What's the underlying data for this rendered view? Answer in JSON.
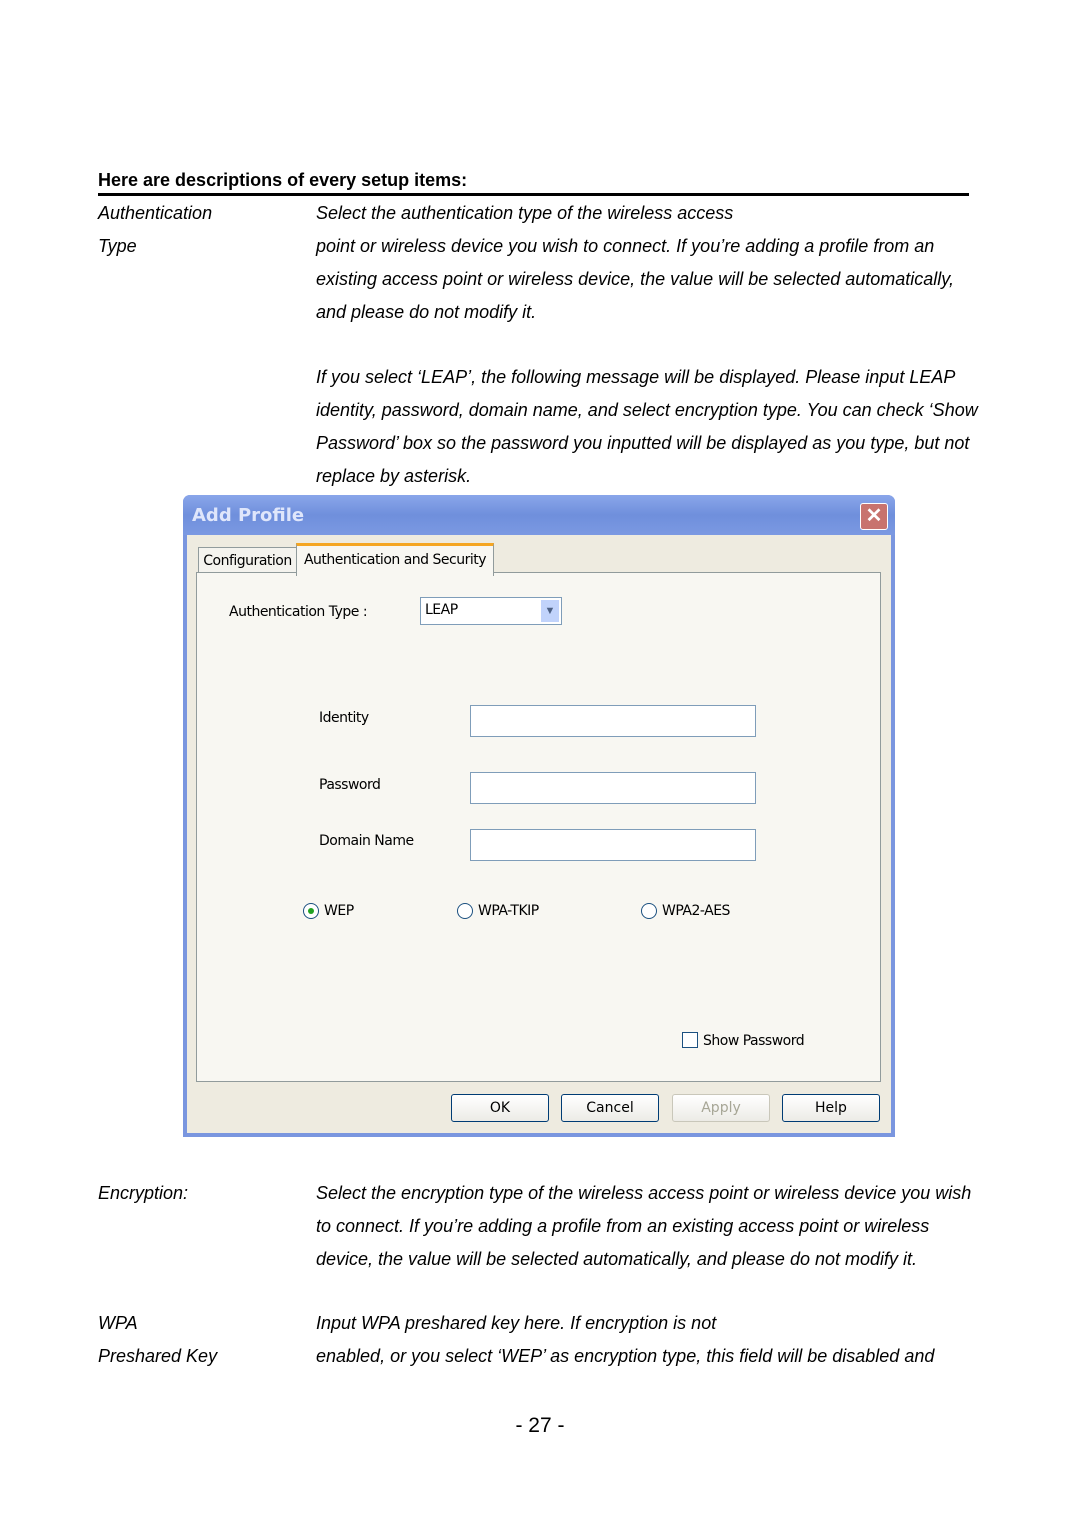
{
  "heading": "Here are descriptions of every setup items:",
  "items": [
    {
      "term": [
        "Authentication",
        "Type"
      ],
      "lines": [
        "Select the authentication type of the wireless access",
        "point or wireless device you wish to connect. If you’re adding a profile from an",
        "existing access point or wireless device, the value will be selected automatically,",
        "and please do not modify it."
      ]
    },
    {
      "lines": [
        "If you select ‘LEAP’, the following message will be displayed. Please input LEAP",
        "identity, password, domain name, and select encryption type. You can check ‘Show",
        "Password’ box so the password you inputted will be displayed as you type, but not",
        "replace by asterisk."
      ]
    },
    {
      "term": [
        "Encryption:"
      ],
      "lines": [
        "Select the encryption type of the wireless access point or wireless device you wish",
        "to connect. If you’re adding a profile from an existing access point or wireless",
        "device, the value will be selected automatically, and please do not modify it."
      ]
    },
    {
      "term": [
        "WPA",
        "Preshared Key"
      ],
      "lines": [
        "Input WPA preshared key here. If encryption is not",
        "enabled, or you select ‘WEP’ as encryption type, this field will be disabled and"
      ]
    }
  ],
  "dialog": {
    "title": "Add Profile",
    "close_icon": "close-x-icon",
    "tabs": [
      "Configuration",
      "Authentication and Security"
    ],
    "active_tab": 1,
    "auth_type_label": "Authentication Type :",
    "auth_type_value": "LEAP",
    "identity_label": "Identity",
    "identity_value": "",
    "password_label": "Password",
    "password_value": "",
    "domain_label": "Domain Name",
    "domain_value": "",
    "encryption_options": [
      "WEP",
      "WPA-TKIP",
      "WPA2-AES"
    ],
    "encryption_selected": "WEP",
    "show_password_label": "Show Password",
    "show_password_checked": false,
    "buttons": {
      "ok": "OK",
      "cancel": "Cancel",
      "apply": "Apply",
      "help": "Help"
    },
    "apply_disabled": true
  },
  "page_number": "- 27 -"
}
